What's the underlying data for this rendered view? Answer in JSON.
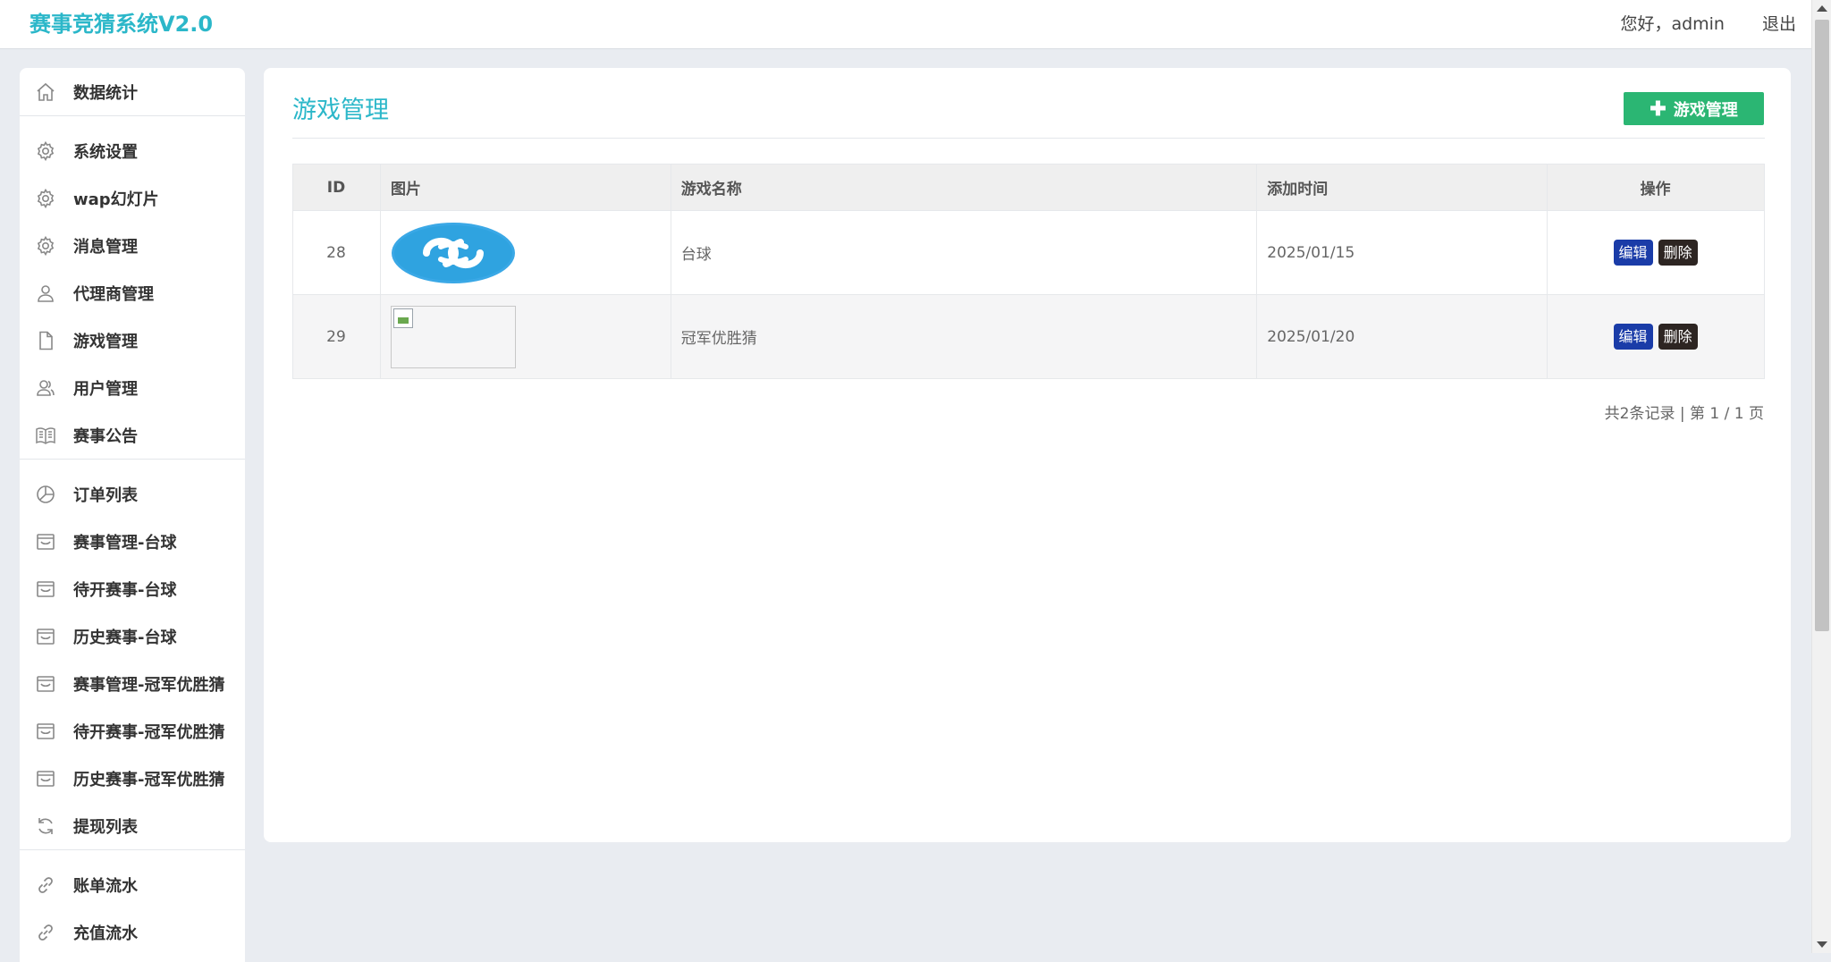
{
  "app": {
    "title": "赛事竞猜系统V2.0",
    "greeting": "您好，admin",
    "logout": "退出"
  },
  "sidebar": {
    "groups": [
      [
        {
          "label": "数据统计",
          "icon": "home-icon"
        }
      ],
      [
        {
          "label": "系统设置",
          "icon": "gear-icon"
        },
        {
          "label": "wap幻灯片",
          "icon": "gear-icon"
        },
        {
          "label": "消息管理",
          "icon": "gear-icon"
        },
        {
          "label": "代理商管理",
          "icon": "user-icon"
        },
        {
          "label": "游戏管理",
          "icon": "file-icon"
        },
        {
          "label": "用户管理",
          "icon": "users-icon"
        },
        {
          "label": "赛事公告",
          "icon": "book-icon"
        }
      ],
      [
        {
          "label": "订单列表",
          "icon": "pie-chart-icon"
        },
        {
          "label": "赛事管理-台球",
          "icon": "inbox-icon"
        },
        {
          "label": "待开赛事-台球",
          "icon": "inbox-icon"
        },
        {
          "label": "历史赛事-台球",
          "icon": "inbox-icon"
        },
        {
          "label": "赛事管理-冠军优胜猜",
          "icon": "inbox-icon"
        },
        {
          "label": "待开赛事-冠军优胜猜",
          "icon": "inbox-icon"
        },
        {
          "label": "历史赛事-冠军优胜猜",
          "icon": "inbox-icon"
        },
        {
          "label": "提现列表",
          "icon": "refresh-icon"
        }
      ],
      [
        {
          "label": "账单流水",
          "icon": "link-icon"
        },
        {
          "label": "充值流水",
          "icon": "link-icon"
        }
      ]
    ]
  },
  "main": {
    "title": "游戏管理",
    "add_button": "游戏管理",
    "table": {
      "headers": [
        "ID",
        "图片",
        "游戏名称",
        "添加时间",
        "操作"
      ],
      "rows": [
        {
          "id": "28",
          "image": "logo",
          "name": "台球",
          "date": "2025/01/15",
          "edit": "编辑",
          "delete": "删除"
        },
        {
          "id": "29",
          "image": "broken",
          "name": "冠军优胜猜",
          "date": "2025/01/20",
          "edit": "编辑",
          "delete": "删除"
        }
      ]
    },
    "pager": "共2条记录 | 第 1 / 1 页"
  },
  "colors": {
    "accent": "#2bb7c9",
    "add_button": "#2bb673",
    "edit_button": "#1a3ca8",
    "delete_button": "#2d2522"
  }
}
